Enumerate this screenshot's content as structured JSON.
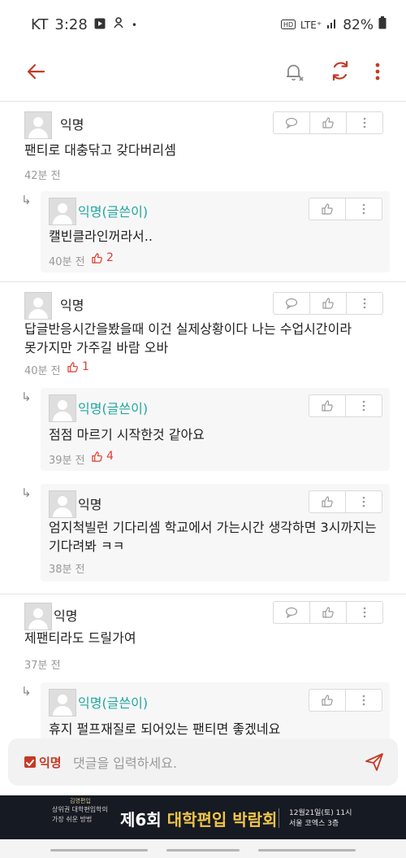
{
  "status": {
    "carrier": "KT",
    "time": "3:28",
    "network": "LTE⁺",
    "battery": "82%"
  },
  "comments": [
    {
      "name": "익명",
      "text": "팬티로 대충닦고 갖다버리셈",
      "time": "42분 전",
      "likes": "",
      "replies": [
        {
          "name": "익명(글쓴이)",
          "is_author": true,
          "text": "캘빈클라인꺼라서..",
          "time": "40분 전",
          "likes": "2"
        }
      ]
    },
    {
      "name": "익명",
      "text": "답글반응시간을봤을때 이건 실제상황이다 나는 수업시간이라\n못가지만 가주길 바람 오바",
      "time": "40분 전",
      "likes": "1",
      "replies": [
        {
          "name": "익명(글쓴이)",
          "is_author": true,
          "text": "점점 마르기 시작한것 같아요",
          "time": "39분 전",
          "likes": "4"
        },
        {
          "name": "익명",
          "is_author": false,
          "text": "엄지척빌런 기다리셈 학교에서 가는시간 생각하면 3시까지는\n기다려봐 ㅋㅋ",
          "time": "38분 전",
          "likes": ""
        }
      ]
    },
    {
      "name": "익명",
      "text": "제팬티라도 드릴가여",
      "time": "37분 전",
      "likes": "",
      "replies": [
        {
          "name": "익명(글쓴이)",
          "is_author": true,
          "text": "휴지 펄프재질로 되어있는 팬티면 좋겠네요",
          "time": "",
          "likes": ""
        }
      ]
    }
  ],
  "compose": {
    "anon_label": "익명",
    "placeholder": "댓글을 입력하세요."
  },
  "ad": {
    "logo": "김영편입",
    "sub_line1": "상위권 대학편입학의",
    "sub_line2": "가장 쉬운 방법",
    "title_prefix": "제6회",
    "title_highlight": "대학편입 박람회",
    "date_line1": "12월21일(토) 11시",
    "date_line2": "서울 코엑스 3층"
  },
  "colors": {
    "accent": "#c43a26",
    "author": "#1fa6a0",
    "like": "#e03d2f"
  }
}
